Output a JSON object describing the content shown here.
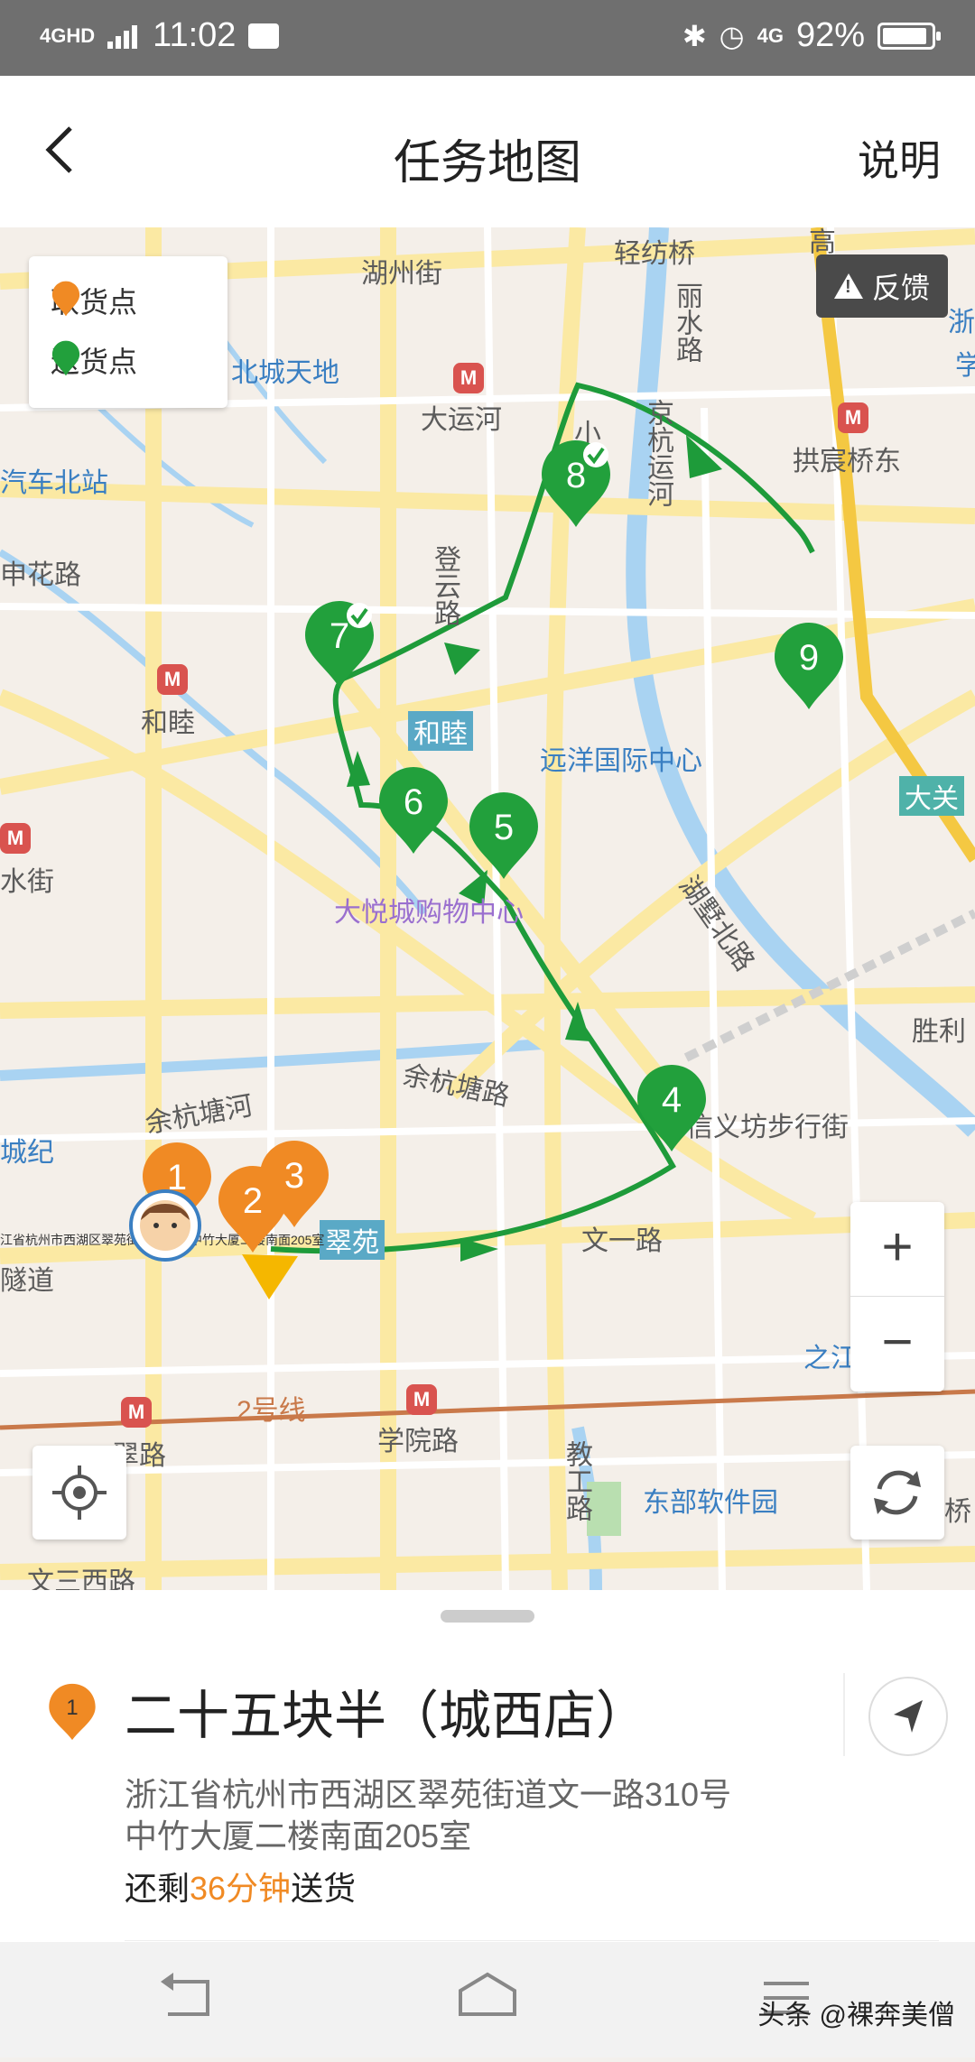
{
  "status_bar": {
    "network": "4GHD",
    "time": "11:02",
    "net_right": "4G",
    "battery_text": "92%",
    "battery_level": 0.92,
    "icons": [
      "signal-icon",
      "mail-icon",
      "bluetooth-icon",
      "vibrate-icon",
      "alarm-icon",
      "data-icon",
      "battery-icon"
    ]
  },
  "header": {
    "title": "任务地图",
    "help_label": "说明",
    "back_icon": "back-arrow-icon"
  },
  "map": {
    "legend": {
      "pickup": "取货点",
      "delivery": "送货点"
    },
    "feedback_label": "反馈",
    "labels": {
      "qingfang": "轻纺桥",
      "huzhou": "湖州街",
      "gao": "高",
      "zhe": "浙",
      "xue": "学",
      "lishui": "丽水路",
      "beicheng": "北城天地",
      "dayunhe": "大运河",
      "bus_north": "汽车北站",
      "xiao": "小",
      "jinghang": "京杭运河",
      "gongchen": "拱宸桥东",
      "huahua": "申花路",
      "dengyun": "登云路",
      "hemu_metro": "和睦",
      "hemu_station": "和睦",
      "yuanyang": "远洋国际中心",
      "daguan": "大关",
      "shuijie": "水街",
      "dayuecheng": "大悦城购物中心",
      "hushu": "湖墅北路",
      "shengli": "胜利",
      "yuhang_river": "余杭塘河",
      "yuhang_road": "余杭塘路",
      "xinyifang": "信义坊步行街",
      "chengji": "城纪",
      "cuiyuan": "翠苑",
      "tunnel": "隧道",
      "wenyi": "文一路",
      "zhijiang": "之江",
      "line2": "2号线",
      "xueyuan": "学院路",
      "cuiroad": "翠路",
      "jiaogong": "教工路",
      "dongbu": "东部软件园",
      "qiao": "桥",
      "wensan": "文三西路",
      "tiny_addr": "江省杭州市西湖区翠苑街道文一路中竹大厦二楼南面205室"
    },
    "pins": [
      {
        "num": "1",
        "type": "pickup"
      },
      {
        "num": "2",
        "type": "pickup"
      },
      {
        "num": "3",
        "type": "pickup"
      },
      {
        "num": "4",
        "type": "delivery"
      },
      {
        "num": "5",
        "type": "delivery"
      },
      {
        "num": "6",
        "type": "delivery"
      },
      {
        "num": "7",
        "type": "delivery",
        "done": true
      },
      {
        "num": "8",
        "type": "delivery",
        "done": true
      },
      {
        "num": "9",
        "type": "delivery"
      }
    ],
    "zoom_in": "+",
    "zoom_out": "−",
    "colors": {
      "pickup": "#f08a24",
      "delivery": "#22a03c",
      "route": "#1e9b3a"
    }
  },
  "sheet": {
    "pin_num": "1",
    "shop_name": "二十五块半（城西店）",
    "address_line1": "浙江省杭州市西湖区翠苑街道文一路310号",
    "address_line2": "中竹大厦二楼南面205室",
    "remain_prefix": "还剩",
    "remain_time": "36分钟",
    "remain_suffix": "送货"
  },
  "watermark": "头条 @裸奔美僧"
}
